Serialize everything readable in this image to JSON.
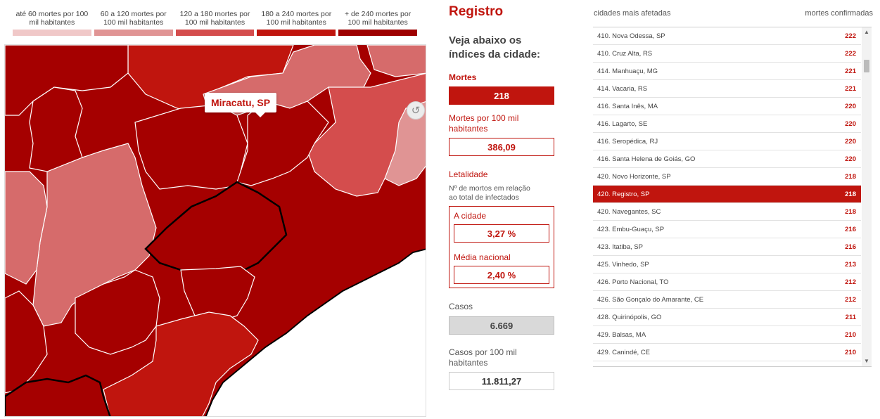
{
  "legend": [
    {
      "label": "até 60 mortes por 100 mil habitantes",
      "color": "#f0c8c8"
    },
    {
      "label": "60 a 120 mortes por 100 mil habitantes",
      "color": "#e09494"
    },
    {
      "label": "120 a 180 mortes por 100 mil habitantes",
      "color": "#d44d4d"
    },
    {
      "label": "180 a 240 mortes por 100 mil habitantes",
      "color": "#c0150e"
    },
    {
      "label": "+ de 240 mortes por 100 mil habitantes",
      "color": "#9e0000"
    }
  ],
  "map": {
    "tooltip": "Miracatu, SP",
    "reset_icon": "undo-icon"
  },
  "info": {
    "city": "Registro",
    "subtitle": "Veja abaixo os índices da cidade:",
    "deaths_label": "Mortes",
    "deaths_value": "218",
    "deaths_per_100k_label": "Mortes por 100 mil habitantes",
    "deaths_per_100k_value": "386,09",
    "lethality_label": "Letalidade",
    "lethality_desc": "Nº de mortos em relação ao total de infectados",
    "city_rate_label": "A cidade",
    "city_rate_value": "3,27 %",
    "national_rate_label": "Média nacional",
    "national_rate_value": "2,40 %",
    "cases_label": "Casos",
    "cases_value": "6.669",
    "cases_per_100k_label": "Casos por 100 mil habitantes",
    "cases_per_100k_value": "11.811,27"
  },
  "ranking": {
    "header_left": "cidades mais afetadas",
    "header_right": "mortes confirmadas",
    "rows": [
      {
        "name": "410. Nova Odessa, SP",
        "value": "222",
        "active": false
      },
      {
        "name": "410. Cruz Alta, RS",
        "value": "222",
        "active": false
      },
      {
        "name": "414. Manhuaçu, MG",
        "value": "221",
        "active": false
      },
      {
        "name": "414. Vacaria, RS",
        "value": "221",
        "active": false
      },
      {
        "name": "416. Santa Inês, MA",
        "value": "220",
        "active": false
      },
      {
        "name": "416. Lagarto, SE",
        "value": "220",
        "active": false
      },
      {
        "name": "416. Seropédica, RJ",
        "value": "220",
        "active": false
      },
      {
        "name": "416. Santa Helena de Goiás, GO",
        "value": "220",
        "active": false
      },
      {
        "name": "420. Novo Horizonte, SP",
        "value": "218",
        "active": false
      },
      {
        "name": "420. Registro, SP",
        "value": "218",
        "active": true
      },
      {
        "name": "420. Navegantes, SC",
        "value": "218",
        "active": false
      },
      {
        "name": "423. Embu-Guaçu, SP",
        "value": "216",
        "active": false
      },
      {
        "name": "423. Itatiba, SP",
        "value": "216",
        "active": false
      },
      {
        "name": "425. Vinhedo, SP",
        "value": "213",
        "active": false
      },
      {
        "name": "426. Porto Nacional, TO",
        "value": "212",
        "active": false
      },
      {
        "name": "426. São Gonçalo do Amarante, CE",
        "value": "212",
        "active": false
      },
      {
        "name": "428. Quirinópolis, GO",
        "value": "211",
        "active": false
      },
      {
        "name": "429. Balsas, MA",
        "value": "210",
        "active": false
      },
      {
        "name": "429. Canindé, CE",
        "value": "210",
        "active": false
      }
    ]
  }
}
